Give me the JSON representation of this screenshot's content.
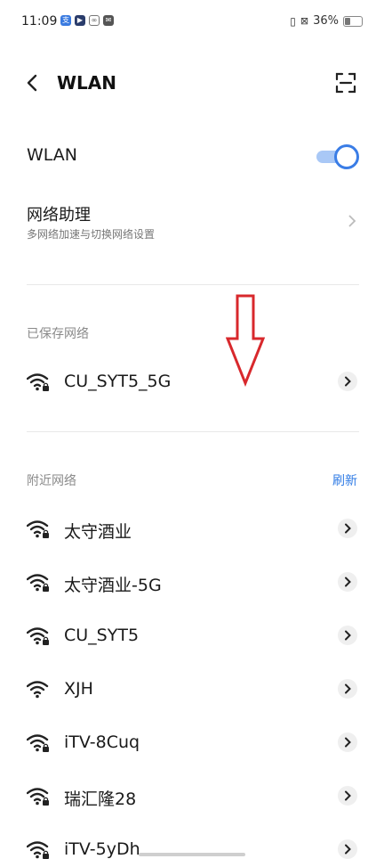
{
  "status": {
    "time": "11:09",
    "battery": "36%",
    "battery_level": 0.36
  },
  "header": {
    "title": "WLAN"
  },
  "wlan_toggle": {
    "label": "WLAN",
    "on": true,
    "accent": "#3a7de6"
  },
  "assistant": {
    "title": "网络助理",
    "subtitle": "多网络加速与切换网络设置"
  },
  "saved": {
    "section_title": "已保存网络",
    "networks": [
      {
        "name": "CU_SYT5_5G",
        "locked": true
      }
    ]
  },
  "nearby": {
    "section_title": "附近网络",
    "refresh_label": "刷新",
    "networks": [
      {
        "name": "太守酒业",
        "locked": true
      },
      {
        "name": "太守酒业-5G",
        "locked": true
      },
      {
        "name": "CU_SYT5",
        "locked": true
      },
      {
        "name": "XJH",
        "locked": false
      },
      {
        "name": "iTV-8Cuq",
        "locked": true
      },
      {
        "name": "瑞汇隆28",
        "locked": true
      },
      {
        "name": "iTV-5yDh",
        "locked": true
      }
    ]
  },
  "colors": {
    "accent": "#2f7be5",
    "annotation_arrow": "#d8282c"
  }
}
